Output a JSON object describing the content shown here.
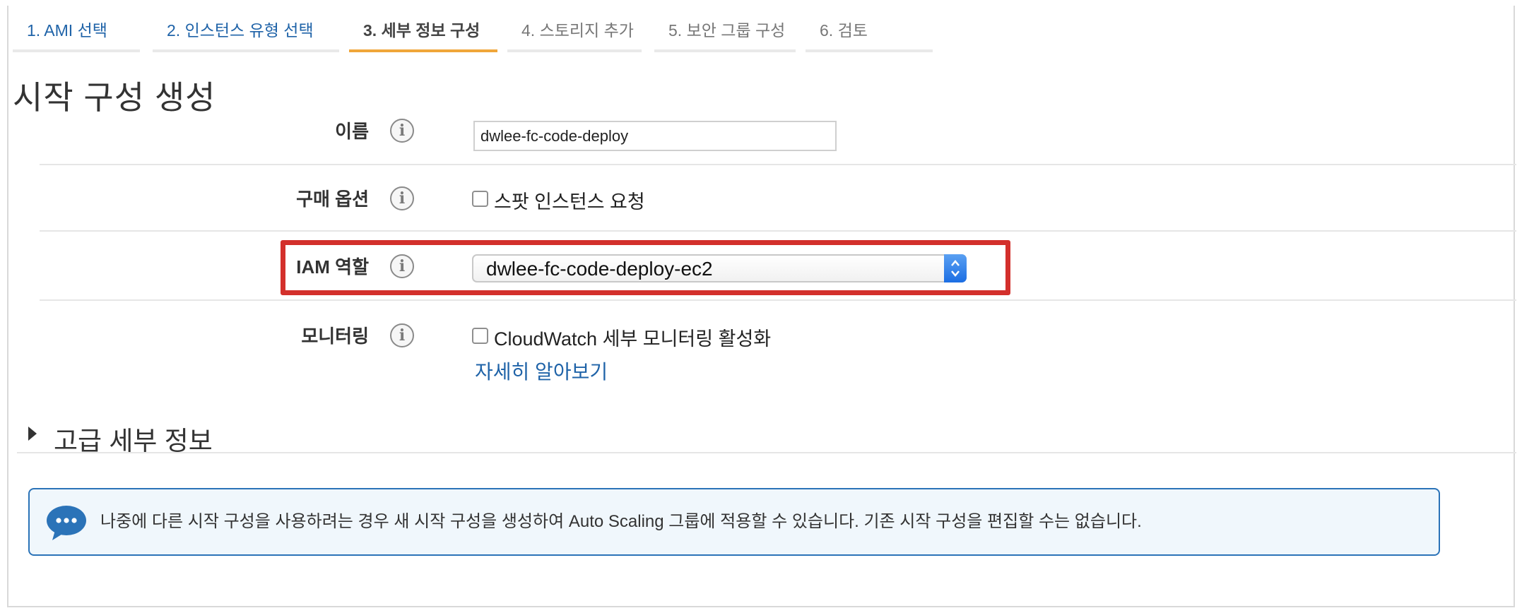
{
  "wizard": {
    "steps": [
      {
        "label": "1. AMI 선택",
        "state": "done"
      },
      {
        "label": "2. 인스턴스 유형 선택",
        "state": "done"
      },
      {
        "label": "3. 세부 정보 구성",
        "state": "active"
      },
      {
        "label": "4. 스토리지 추가",
        "state": "todo"
      },
      {
        "label": "5. 보안 그룹 구성",
        "state": "todo"
      },
      {
        "label": "6. 검토",
        "state": "todo"
      }
    ],
    "active_color": "#f0a63a"
  },
  "page": {
    "title": "시작 구성 생성"
  },
  "form": {
    "name": {
      "label": "이름",
      "value": "dwlee-fc-code-deploy",
      "info_icon": "info-icon"
    },
    "purchase": {
      "label": "구매 옵션",
      "checkbox_label": "스팟 인스턴스 요청",
      "checked": false
    },
    "iam_role": {
      "label": "IAM 역할",
      "selected": "dwlee-fc-code-deploy-ec2",
      "highlight_color": "#d3302c"
    },
    "monitoring": {
      "label": "모니터링",
      "checkbox_label": "CloudWatch 세부 모니터링 활성화",
      "checked": false,
      "learn_more": "자세히 알아보기"
    }
  },
  "advanced": {
    "label": "고급 세부 정보",
    "icon": "caret-right-icon"
  },
  "notice": {
    "icon": "chat-bubble-icon",
    "text": "나중에 다른 시작 구성을 사용하려는 경우 새 시작 구성을 생성하여 Auto Scaling 그룹에 적용할 수 있습니다. 기존 시작 구성을 편집할 수는 없습니다."
  }
}
